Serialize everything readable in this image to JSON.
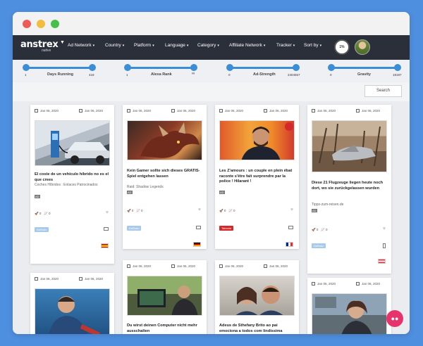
{
  "colors": {
    "accent": "#3b8ed5",
    "navbar": "#2a2f3a",
    "background": "#4f8fdf",
    "chat": "#e6336b"
  },
  "logo": {
    "main": "anstrex",
    "sub": "native"
  },
  "nav": [
    "Ad Network",
    "Country",
    "Platform",
    "Language",
    "Category",
    "Affiliate Network",
    "Tracker",
    "Sort by"
  ],
  "counter": "1%",
  "filters": [
    {
      "title": "Days Running",
      "min": "1",
      "max": "418"
    },
    {
      "title": "Alexa Rank",
      "min": "1",
      "max": "∞"
    },
    {
      "title": "Ad-Strength",
      "min": "0",
      "max": "2404557"
    },
    {
      "title": "Gravity",
      "min": "0",
      "max": "19197"
    }
  ],
  "search_label": "Search",
  "ad_label": "AD",
  "cards": [
    {
      "date1": "Jan 06, 2020",
      "date2": "Jan 06, 2020",
      "title": "El coste de un vehículo híbrido no es el que crees",
      "source": "Coches Híbridos : Enlaces Patrocinados",
      "shares": "0",
      "trend": "0",
      "badge": "DeBrain",
      "flag": "es-flag",
      "icon": "car-charging"
    },
    {
      "date1": "Jan 06, 2020",
      "date2": "Jan 06, 2020",
      "title": "Kein Gamer sollte sich dieses GRATIS-Spiel entgehen lassen",
      "source": "Raid: Shadow Legends",
      "shares": "0",
      "trend": "0",
      "badge": "DeBrain",
      "flag": "de-flag",
      "icon": "dragon"
    },
    {
      "date1": "Jan 06, 2020",
      "date2": "Jan 06, 2020",
      "title": "Les Z'amours : un couple en plein ébat raconte s'être fait surprendre par la police ! Hilarant !",
      "source": "",
      "shares": "0",
      "trend": "0",
      "badge": "Taboola",
      "flag": "fr-flag",
      "icon": "tv-host"
    },
    {
      "date1": "Jan 06, 2020",
      "date2": "Jan 06, 2020",
      "title": "Diese 21 Flugzeuge liegen heute noch dort, wo sie zurückgelassen wurden",
      "source": "Tipps-zum-reisen.de",
      "shares": "0",
      "trend": "0",
      "badge": "DeBrain",
      "flag": "at-flag",
      "icon": "plane-wreck"
    },
    {
      "date1": "Jan 06, 2020",
      "date2": "Jan 06, 2020",
      "title": "",
      "source": "",
      "icon": "mechanic"
    },
    {
      "date1": "Jan 06, 2020",
      "date2": "Jan 06, 2020",
      "title": "Du wirst deinen Computer nicht mehr ausschalten",
      "source": "",
      "icon": "computer-gamer"
    },
    {
      "date1": "Jan 06, 2020",
      "date2": "Jan 06, 2020",
      "title": "Adeus de Sthefany Brito ao pai emociona a todos com lindíssima",
      "source": "",
      "icon": "couple-selfie"
    },
    {
      "date1": "Jan 06, 2020",
      "date2": "Jan 06, 2020",
      "title": "",
      "source": "",
      "icon": "woman-boat"
    }
  ]
}
